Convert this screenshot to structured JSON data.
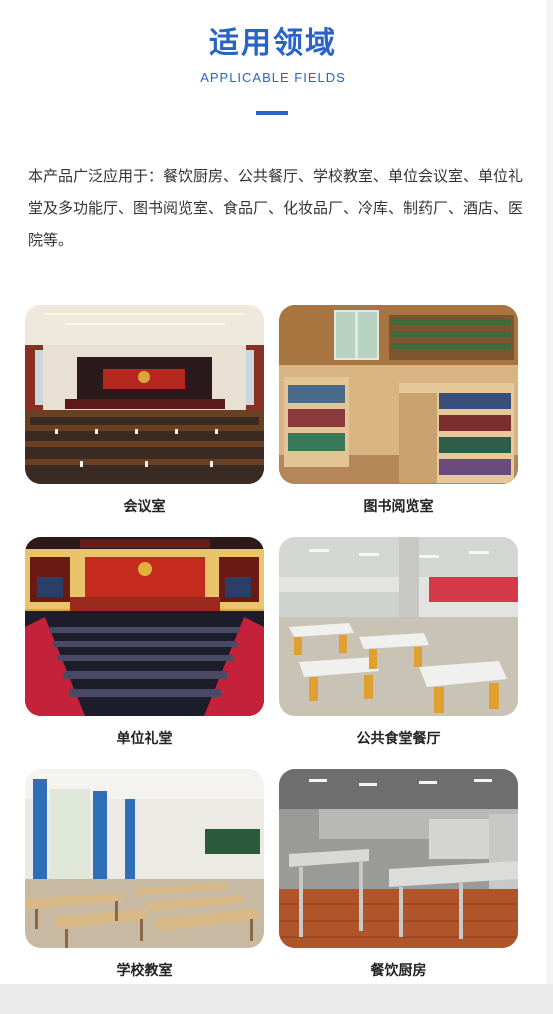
{
  "section": {
    "title": "适用领域",
    "subtitle": "APPLICABLE FIELDS",
    "intro": "本产品广泛应用于：餐饮厨房、公共餐厅、学校教室、单位会议室、单位礼堂及多功能厅、图书阅览室、食品厂、化妆品厂、冷库、制药厂、酒店、医院等。"
  },
  "fields": [
    {
      "label": "会议室"
    },
    {
      "label": "图书阅览室"
    },
    {
      "label": "单位礼堂"
    },
    {
      "label": "公共食堂餐厅"
    },
    {
      "label": "学校教室"
    },
    {
      "label": "餐饮厨房"
    }
  ],
  "colors": {
    "accent": "#2a63c6"
  }
}
